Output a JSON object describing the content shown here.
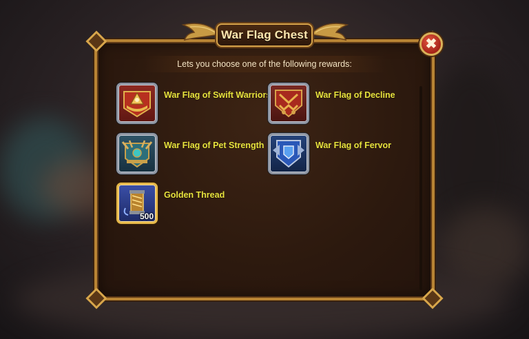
{
  "dialog": {
    "title": "War Flag Chest",
    "subtitle": "Lets you choose one of the following rewards:",
    "close_icon": "✖"
  },
  "rewards": [
    {
      "name": "War Flag of Swift Warriors",
      "icon": "swift-warriors-flag-icon"
    },
    {
      "name": "War Flag of Decline",
      "icon": "decline-flag-icon"
    },
    {
      "name": "War Flag of Pet Strength",
      "icon": "pet-strength-flag-icon"
    },
    {
      "name": "War Flag of Fervor",
      "icon": "fervor-flag-icon"
    },
    {
      "name": "Golden Thread",
      "icon": "golden-thread-icon",
      "quantity": "500"
    }
  ],
  "colors": {
    "label": "#e6e23d",
    "frame_gold": "#b88434",
    "close_red": "#c23a28"
  }
}
